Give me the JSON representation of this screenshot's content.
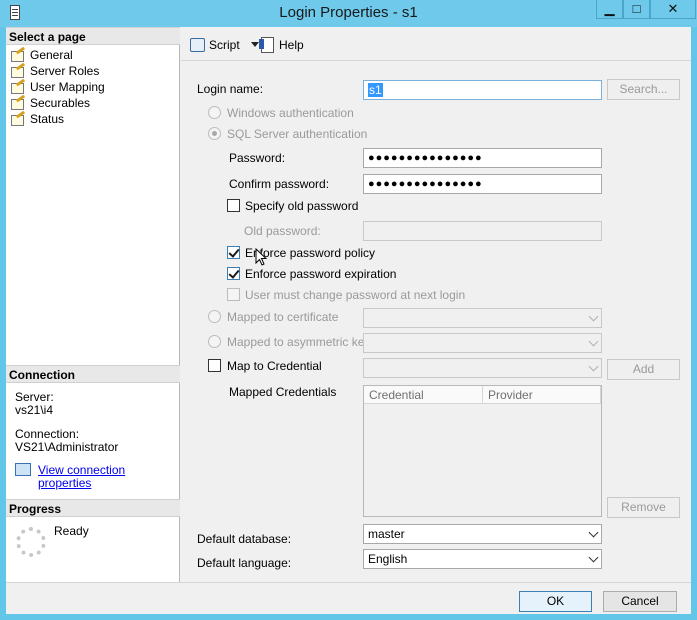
{
  "window": {
    "title": "Login Properties - s1"
  },
  "left": {
    "select_page_header": "Select a page",
    "pages": [
      {
        "label": "General"
      },
      {
        "label": "Server Roles"
      },
      {
        "label": "User Mapping"
      },
      {
        "label": "Securables"
      },
      {
        "label": "Status"
      }
    ],
    "connection_header": "Connection",
    "server_label": "Server:",
    "server_value": "vs21\\i4",
    "connection_label": "Connection:",
    "connection_value": "VS21\\Administrator",
    "view_connection_link": "View connection properties",
    "progress_header": "Progress",
    "progress_status": "Ready"
  },
  "toolbar": {
    "script_label": "Script",
    "help_label": "Help"
  },
  "form": {
    "login_name_label": "Login name:",
    "login_name_value": "s1",
    "search_button": "Search...",
    "windows_auth_label": "Windows authentication",
    "sql_auth_label": "SQL Server authentication",
    "password_label": "Password:",
    "password_value": "●●●●●●●●●●●●●●●",
    "confirm_password_label": "Confirm password:",
    "confirm_password_value": "●●●●●●●●●●●●●●●",
    "specify_old_password_label": "Specify old password",
    "old_password_label": "Old password:",
    "enforce_policy_label": "Enforce password policy",
    "enforce_expiration_label": "Enforce password expiration",
    "must_change_label": "User must change password at next login",
    "mapped_cert_label": "Mapped to certificate",
    "mapped_asym_label": "Mapped to asymmetric key",
    "map_credential_label": "Map to Credential",
    "add_button": "Add",
    "mapped_credentials_label": "Mapped Credentials",
    "grid_columns": [
      "Credential",
      "Provider"
    ],
    "remove_button": "Remove",
    "default_db_label": "Default database:",
    "default_db_value": "master",
    "default_lang_label": "Default language:",
    "default_lang_value": "English"
  },
  "buttons": {
    "ok": "OK",
    "cancel": "Cancel"
  },
  "window_buttons": {
    "minimize": "▁",
    "maximize": "□",
    "close": "✕"
  }
}
